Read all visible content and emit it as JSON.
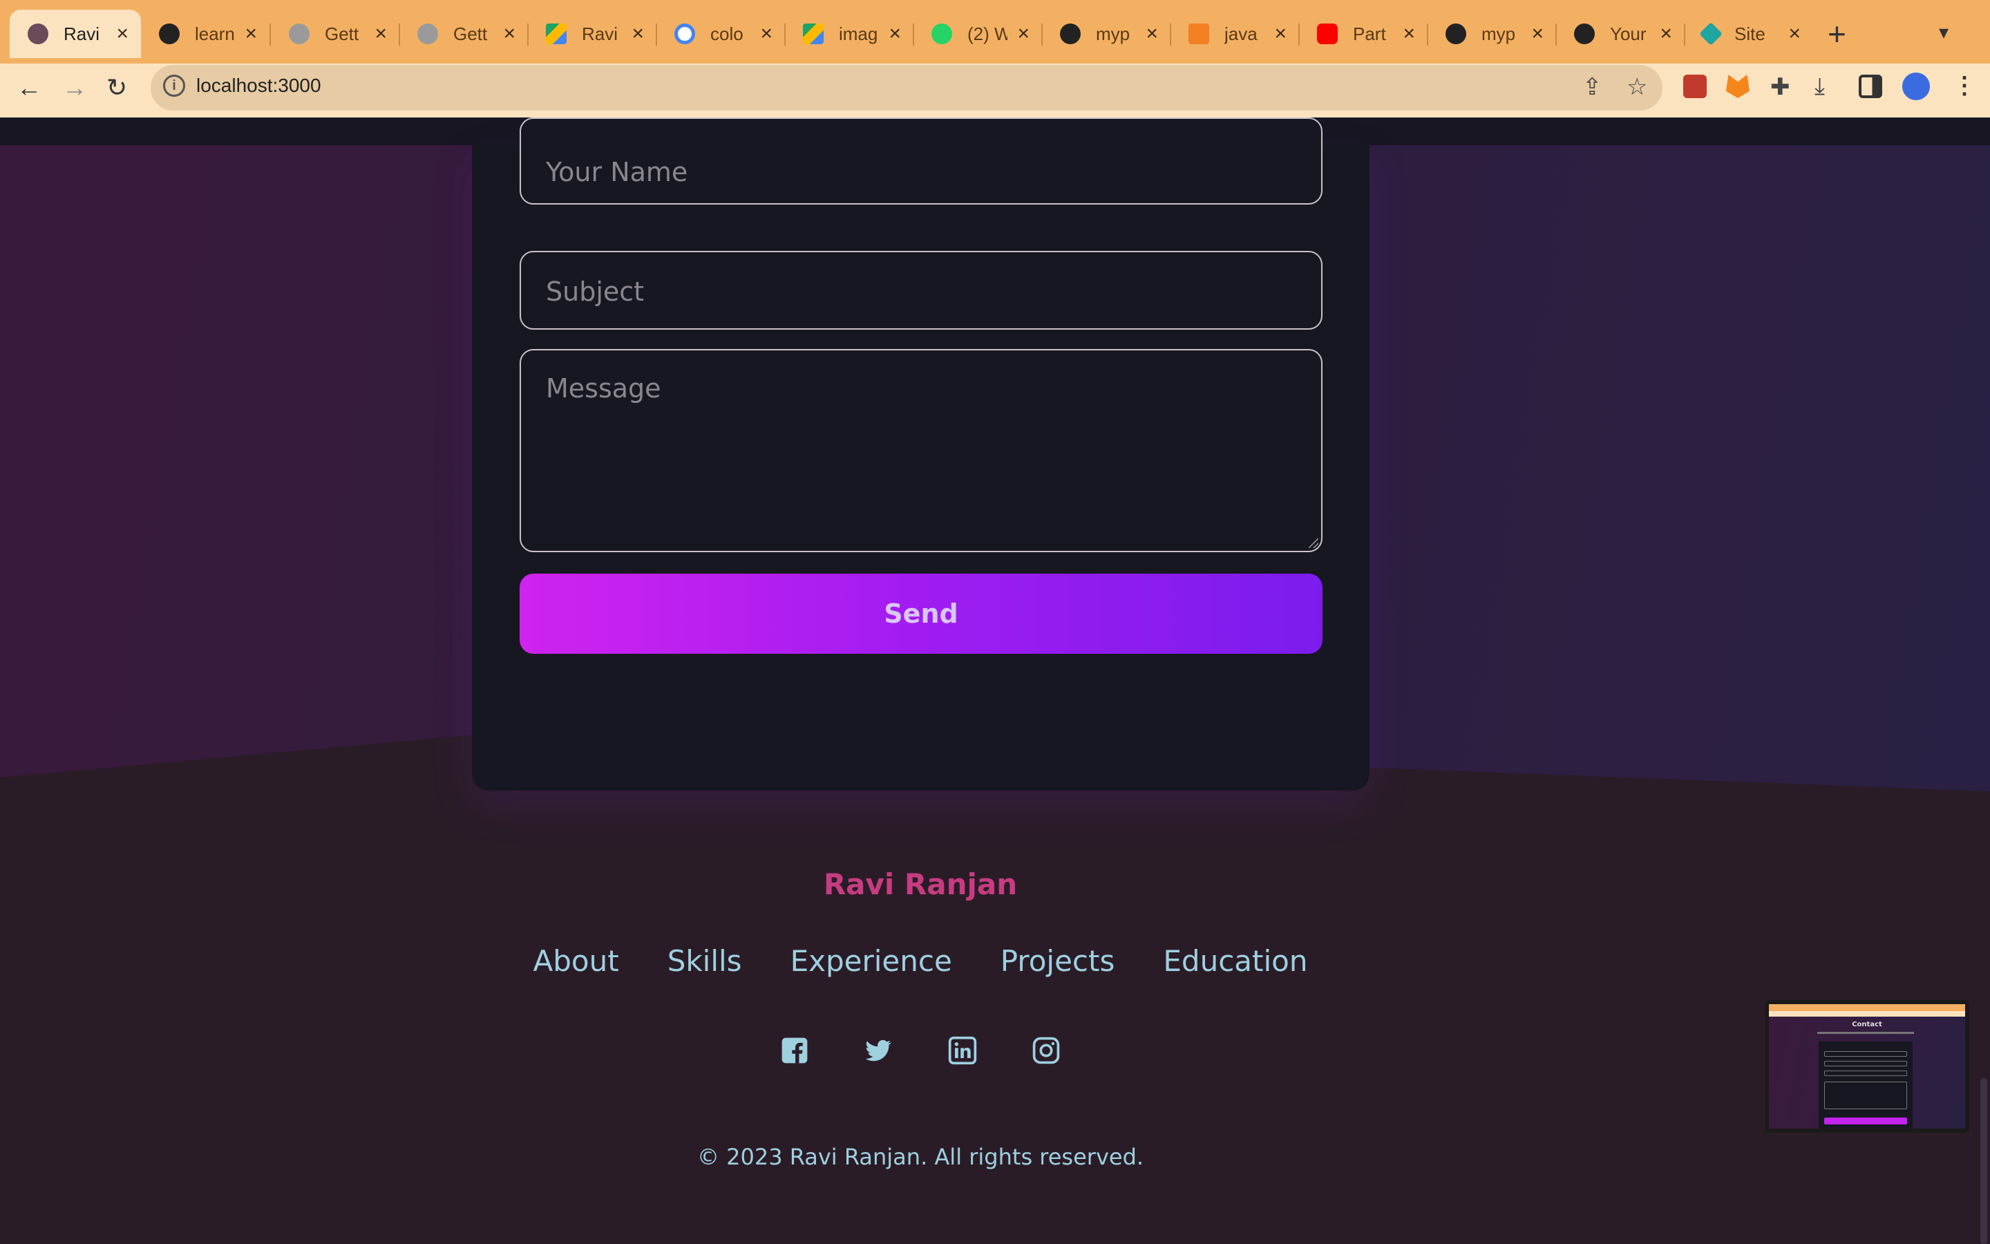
{
  "browser": {
    "tabs": [
      {
        "title": "Ravi",
        "icon": "profile-photo-icon",
        "active": true
      },
      {
        "title": "learn",
        "icon": "github-icon"
      },
      {
        "title": "Gett",
        "icon": "globe-icon"
      },
      {
        "title": "Gett",
        "icon": "globe-icon"
      },
      {
        "title": "Ravi",
        "icon": "google-drive-icon"
      },
      {
        "title": "colo",
        "icon": "google-icon"
      },
      {
        "title": "imag",
        "icon": "google-drive-icon"
      },
      {
        "title": "(2) W",
        "icon": "whatsapp-icon"
      },
      {
        "title": "myp",
        "icon": "github-icon"
      },
      {
        "title": "java",
        "icon": "stackoverflow-icon"
      },
      {
        "title": "Part",
        "icon": "youtube-icon"
      },
      {
        "title": "myp",
        "icon": "github-icon"
      },
      {
        "title": "Your",
        "icon": "github-icon"
      },
      {
        "title": "Site",
        "icon": "site-icon"
      }
    ],
    "url": "localhost:3000"
  },
  "form": {
    "name_placeholder": "Your Name",
    "subject_placeholder": "Subject",
    "message_placeholder": "Message",
    "send_label": "Send"
  },
  "footer": {
    "name": "Ravi Ranjan",
    "nav": [
      "About",
      "Skills",
      "Experience",
      "Projects",
      "Education"
    ],
    "social": [
      "facebook-icon",
      "twitter-icon",
      "linkedin-icon",
      "instagram-icon"
    ],
    "copyright": "© 2023 Ravi Ranjan. All rights reserved."
  },
  "thumbnail": {
    "title": "Contact"
  },
  "colors": {
    "accent_name": "#c73c81",
    "link": "#9ed0e0",
    "button_start": "#d023ef",
    "button_end": "#7b1ced",
    "tabbar": "#f3b063"
  }
}
